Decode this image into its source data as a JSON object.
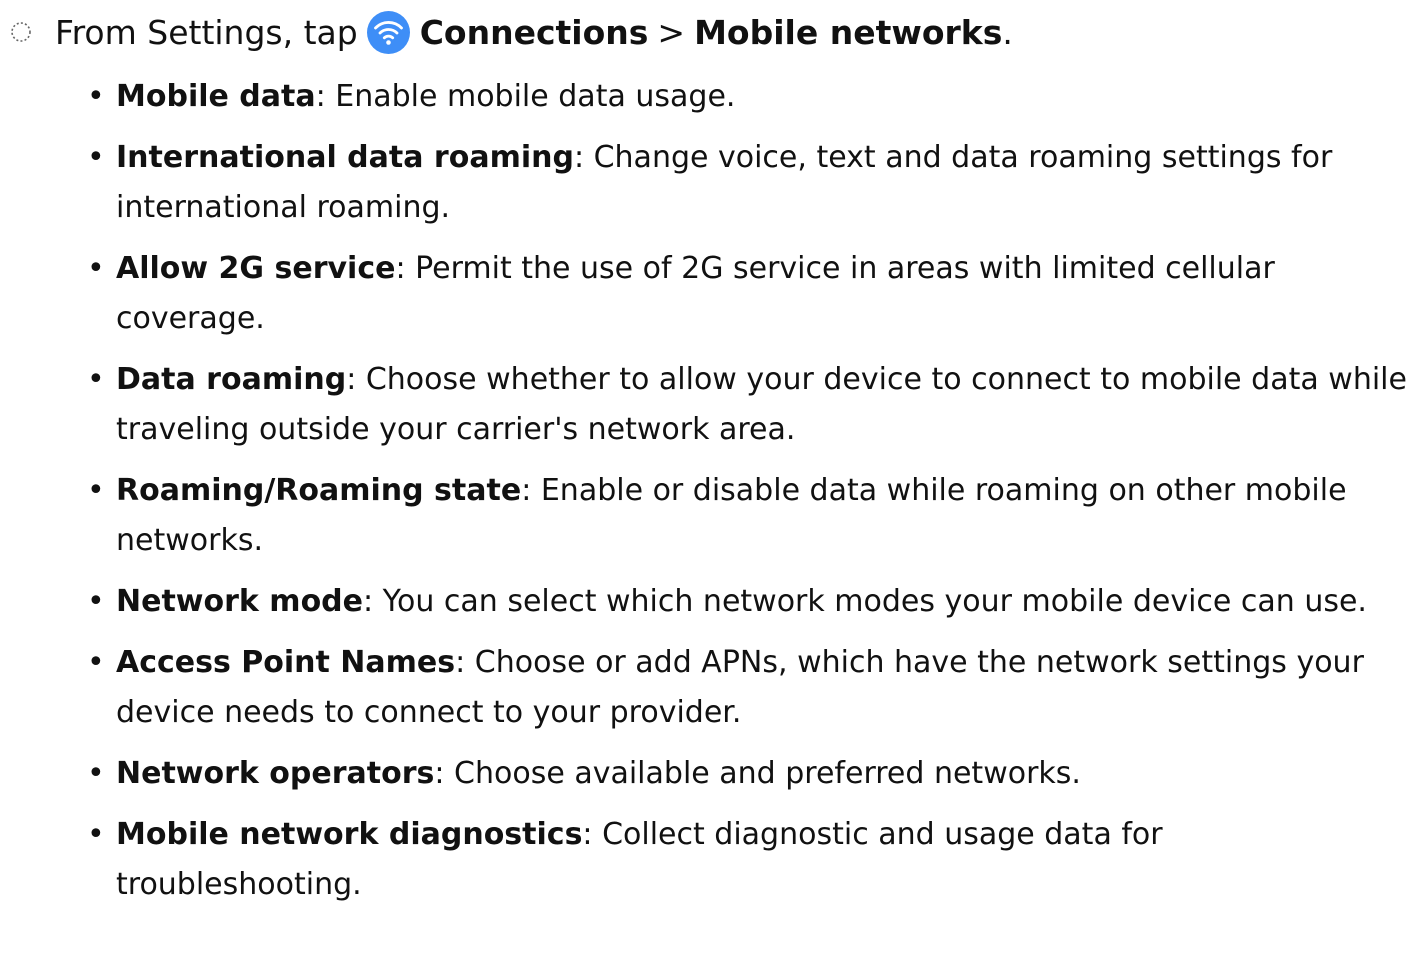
{
  "step": {
    "intro": "From Settings, tap",
    "path_first": "Connections",
    "separator": ">",
    "path_second": "Mobile networks",
    "end": ".",
    "icon": "wifi-icon",
    "icon_color": "#3e8ef7",
    "marker_icon": "dotted-circle-icon"
  },
  "items": [
    {
      "term": "Mobile data",
      "desc": ": Enable mobile data usage."
    },
    {
      "term": "International data roaming",
      "desc": ": Change voice, text and data roaming settings for international roaming."
    },
    {
      "term": "Allow 2G service",
      "desc": ": Permit the use of 2G service in areas with limited cellular coverage."
    },
    {
      "term": "Data roaming",
      "desc": ": Choose whether to allow your device to connect to mobile data while traveling outside your carrier's network area."
    },
    {
      "term": "Roaming/Roaming state",
      "desc": ": Enable or disable data while roaming on other mobile networks."
    },
    {
      "term": "Network mode",
      "desc": ": You can select which network modes your mobile device can use."
    },
    {
      "term": "Access Point Names",
      "desc": ": Choose or add APNs, which have the network settings your device needs to connect to your provider."
    },
    {
      "term": "Network operators",
      "desc": ": Choose available and preferred networks."
    },
    {
      "term": "Mobile network diagnostics",
      "desc": ": Collect diagnostic and usage data for troubleshooting."
    }
  ]
}
